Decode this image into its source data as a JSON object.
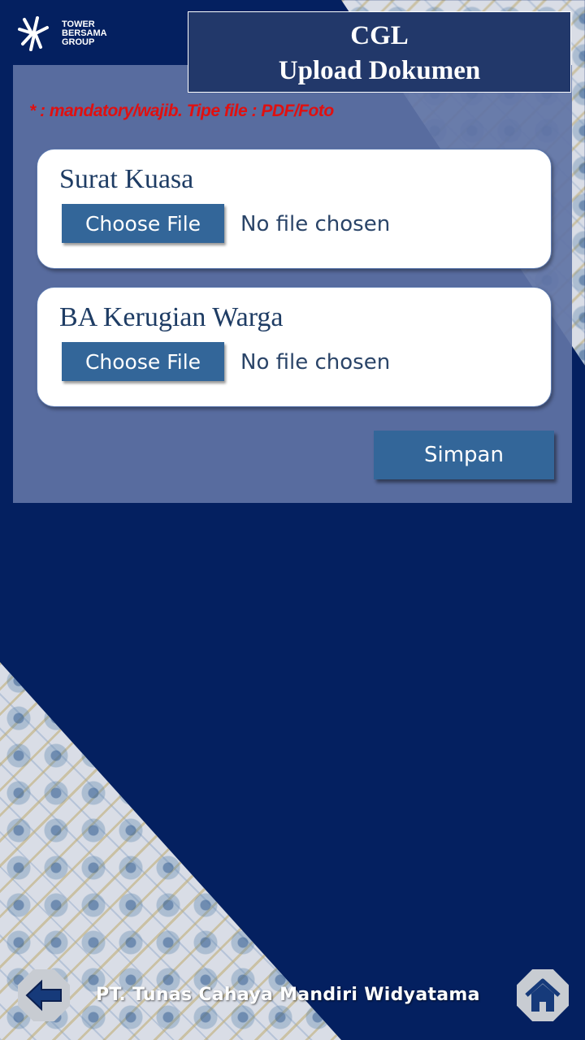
{
  "brand": {
    "logo_line1": "TOWER",
    "logo_line2": "BERSAMA",
    "logo_line3": "GROUP"
  },
  "header": {
    "title_line1": "CGL",
    "title_line2": "Upload Dokumen"
  },
  "form": {
    "note": "* : mandatory/wajib. Tipe file : PDF/Foto",
    "fields": [
      {
        "label": "Surat Kuasa",
        "button_label": "Choose File",
        "status": "No file chosen"
      },
      {
        "label": "BA Kerugian Warga",
        "button_label": "Choose File",
        "status": "No file chosen"
      }
    ],
    "save_label": "Simpan"
  },
  "footer": {
    "company": "PT. Tunas Cahaya Mandiri Widyatama",
    "back_icon": "arrow-left-icon",
    "home_icon": "home-icon"
  },
  "colors": {
    "background": "#042060",
    "panel": "#5f73a5",
    "button": "#336699",
    "mandatory_note": "#e01010"
  }
}
